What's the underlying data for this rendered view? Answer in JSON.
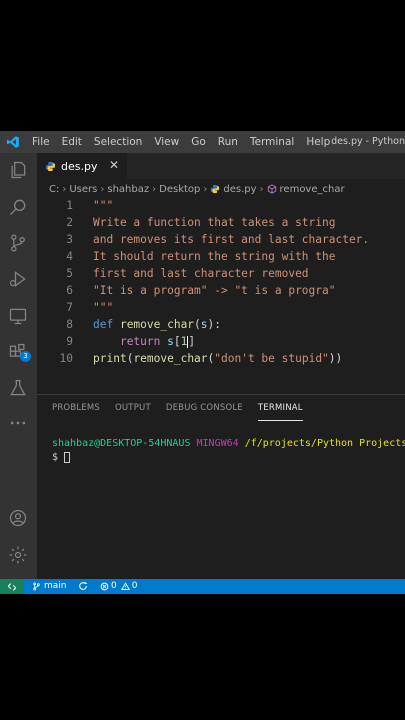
{
  "menubar": {
    "items": [
      "File",
      "Edit",
      "Selection",
      "View",
      "Go",
      "Run",
      "Terminal",
      "Help"
    ],
    "title": "des.py - Python"
  },
  "tab": {
    "label": "des.py",
    "close": "✕"
  },
  "breadcrumb": [
    "C:",
    "Users",
    "shahbaz",
    "Desktop",
    "des.py",
    "remove_char"
  ],
  "editor": {
    "lines": [
      {
        "no": "1",
        "parts": [
          {
            "c": "str",
            "t": "\"\"\""
          }
        ]
      },
      {
        "no": "2",
        "parts": [
          {
            "c": "str",
            "t": "Write a function that takes a string"
          }
        ]
      },
      {
        "no": "3",
        "parts": [
          {
            "c": "str",
            "t": "and removes its first and last character."
          }
        ]
      },
      {
        "no": "4",
        "parts": [
          {
            "c": "str",
            "t": "It should return the string with the"
          }
        ]
      },
      {
        "no": "5",
        "parts": [
          {
            "c": "str",
            "t": "first and last character removed"
          }
        ]
      },
      {
        "no": "6",
        "parts": [
          {
            "c": "str",
            "t": "\"It is a program\" -> \"t is a progra\""
          }
        ]
      },
      {
        "no": "7",
        "parts": [
          {
            "c": "str",
            "t": "\"\"\""
          }
        ]
      },
      {
        "no": "8",
        "parts": [
          {
            "c": "kw",
            "t": "def "
          },
          {
            "c": "fn",
            "t": "remove_char"
          },
          {
            "c": "pl",
            "t": "("
          },
          {
            "c": "var",
            "t": "s"
          },
          {
            "c": "pl",
            "t": "):"
          }
        ]
      },
      {
        "no": "9",
        "parts": [
          {
            "c": "pl",
            "t": "    "
          },
          {
            "c": "kw2",
            "t": "return "
          },
          {
            "c": "var",
            "t": "s"
          },
          {
            "c": "pl",
            "t": "["
          },
          {
            "c": "num",
            "t": "1"
          },
          {
            "c": "cursor",
            "t": ""
          },
          {
            "c": "pl",
            "t": "]"
          }
        ]
      },
      {
        "no": "10",
        "parts": [
          {
            "c": "fn",
            "t": "print"
          },
          {
            "c": "pl",
            "t": "("
          },
          {
            "c": "fn",
            "t": "remove_char"
          },
          {
            "c": "pl",
            "t": "("
          },
          {
            "c": "str",
            "t": "\"don't be stupid\""
          },
          {
            "c": "pl",
            "t": "))"
          }
        ]
      }
    ]
  },
  "panel": {
    "tabs": [
      "PROBLEMS",
      "OUTPUT",
      "DEBUG CONSOLE",
      "TERMINAL"
    ],
    "active_tab": "TERMINAL",
    "terminal": {
      "user": "shahbaz@DESKTOP-54HNAUS",
      "system": "MINGW64",
      "path": "/f/projects/Python Projects/Py",
      "prompt": "$ "
    }
  },
  "statusbar": {
    "branch": "main",
    "errors": "0",
    "warnings": "0"
  },
  "activity": {
    "extensions_badge": "3"
  },
  "colors": {
    "accent": "#007acc",
    "remote": "#16825d",
    "string": "#ce9178",
    "keyword": "#569cd6",
    "function": "#dcdcaa"
  }
}
